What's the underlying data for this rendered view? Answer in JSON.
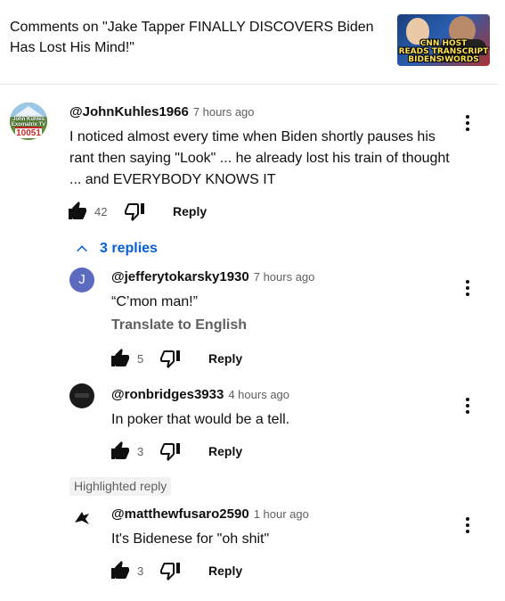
{
  "header": {
    "title": "Comments on \"Jake Tapper FINALLY DISCOVERS Biden Has Lost His Mind!\"",
    "thumbnail_caption": [
      "CNN HOST",
      "READS TRANSCRIPT OF",
      "BIDENS WORDS"
    ]
  },
  "comment": {
    "author": "@JohnKuhles1966",
    "time": "7 hours ago",
    "text": "I noticed almost every time when Biden shortly pauses his rant then saying \"Look\"  ... he already lost his train of thought ... and EVERYBODY KNOWS IT",
    "likes": "42",
    "reply_label": "Reply",
    "avatar_text": [
      "John Kuhles",
      "Exomatrix TV",
      "10051"
    ]
  },
  "replies_toggle": {
    "label": "3 replies"
  },
  "replies": [
    {
      "author": "@jefferytokarsky1930",
      "time": "7 hours ago",
      "text": "“C’mon man!”",
      "translate_label": "Translate to English",
      "likes": "5",
      "reply_label": "Reply",
      "avatar_initial": "J",
      "avatar_color": "#5c6bc0"
    },
    {
      "author": "@ronbridges3933",
      "time": "4 hours ago",
      "text": "In poker that would be a tell.",
      "likes": "3",
      "reply_label": "Reply"
    },
    {
      "highlight_label": "Highlighted reply",
      "author": "@matthewfusaro2590",
      "time": "1 hour ago",
      "text": "It's Bidenese for \"oh shit\"",
      "likes": "3",
      "reply_label": "Reply"
    }
  ],
  "icons": {
    "like": "thumbs-up-icon",
    "dislike": "thumbs-down-icon",
    "menu": "more-vert-icon",
    "collapse": "chevron-up-icon"
  },
  "colors": {
    "link": "#065fd4",
    "secondary_text": "#606060"
  }
}
